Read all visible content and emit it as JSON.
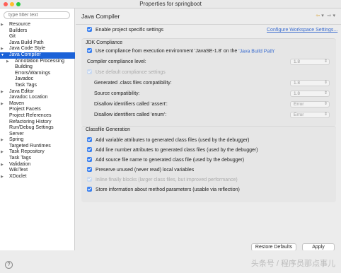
{
  "window": {
    "title": "Properties for springboot"
  },
  "filter": {
    "placeholder": "type filter text"
  },
  "tree": [
    {
      "label": "Resource",
      "indent": 0,
      "arrow": "right"
    },
    {
      "label": "Builders",
      "indent": 0
    },
    {
      "label": "Git",
      "indent": 0
    },
    {
      "label": "Java Build Path",
      "indent": 0
    },
    {
      "label": "Java Code Style",
      "indent": 0,
      "arrow": "right"
    },
    {
      "label": "Java Compiler",
      "indent": 0,
      "arrow": "down",
      "selected": true
    },
    {
      "label": "Annotation Processing",
      "indent": 1,
      "arrow": "right"
    },
    {
      "label": "Building",
      "indent": 1
    },
    {
      "label": "Errors/Warnings",
      "indent": 1
    },
    {
      "label": "Javadoc",
      "indent": 1
    },
    {
      "label": "Task Tags",
      "indent": 1
    },
    {
      "label": "Java Editor",
      "indent": 0,
      "arrow": "right"
    },
    {
      "label": "Javadoc Location",
      "indent": 0
    },
    {
      "label": "Maven",
      "indent": 0,
      "arrow": "right"
    },
    {
      "label": "Project Facets",
      "indent": 0
    },
    {
      "label": "Project References",
      "indent": 0
    },
    {
      "label": "Refactoring History",
      "indent": 0
    },
    {
      "label": "Run/Debug Settings",
      "indent": 0
    },
    {
      "label": "Server",
      "indent": 0
    },
    {
      "label": "Spring",
      "indent": 0,
      "arrow": "right"
    },
    {
      "label": "Targeted Runtimes",
      "indent": 0
    },
    {
      "label": "Task Repository",
      "indent": 0,
      "arrow": "right"
    },
    {
      "label": "Task Tags",
      "indent": 0
    },
    {
      "label": "Validation",
      "indent": 0,
      "arrow": "right"
    },
    {
      "label": "WikiText",
      "indent": 0
    },
    {
      "label": "XDoclet",
      "indent": 0,
      "arrow": "right"
    }
  ],
  "page": {
    "title": "Java Compiler",
    "enable_label": "Enable project specific settings",
    "configure_link": "Configure Workspace Settings...",
    "jdk_group": "JDK Compliance",
    "use_compliance_prefix": "Use compliance from execution environment 'JavaSE-1.8' on the ",
    "use_compliance_link": "'Java Build Path'",
    "compliance_level_label": "Compiler compliance level:",
    "compliance_level_value": "1.8",
    "use_default_label": "Use default compliance settings",
    "generated_label": "Generated .class files compatibility:",
    "generated_value": "1.8",
    "source_label": "Source compatibility:",
    "source_value": "1.8",
    "assert_label": "Disallow identifiers called 'assert':",
    "assert_value": "Error",
    "enum_label": "Disallow identifiers called 'enum':",
    "enum_value": "Error",
    "classfile_group": "Classfile Generation",
    "opt_var": "Add variable attributes to generated class files (used by the debugger)",
    "opt_line": "Add line number attributes to generated class files (used by the debugger)",
    "opt_source": "Add source file name to generated class file (used by the debugger)",
    "opt_preserve": "Preserve unused (never read) local variables",
    "opt_inline": "Inline finally blocks (larger class files, but improved performance)",
    "opt_store": "Store information about method parameters (usable via reflection)"
  },
  "buttons": {
    "restore": "Restore Defaults",
    "apply": "Apply"
  },
  "nav": {
    "back": "⇦",
    "menu": "▾",
    "forward": "⇨"
  },
  "help": {
    "glyph": "?"
  },
  "watermark": {
    "text": "头条号 / 程序员那点事儿"
  }
}
